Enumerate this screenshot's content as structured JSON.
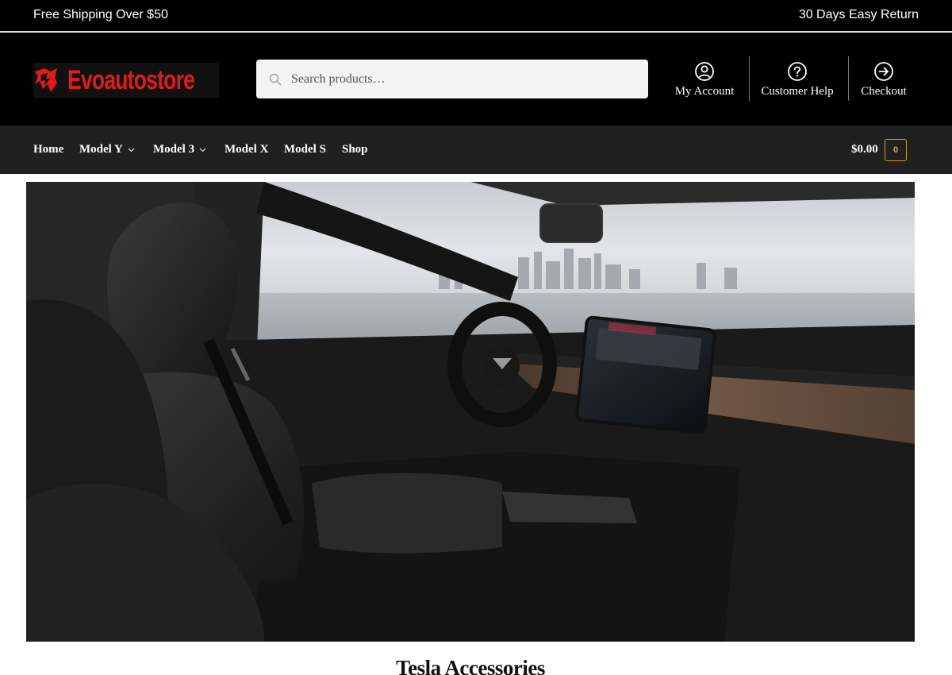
{
  "topbar": {
    "left_text": "Free Shipping Over $50",
    "right_text": "30 Days Easy Return"
  },
  "brand": {
    "logo_text": "Evoautostore",
    "accent_color": "#e11b1b"
  },
  "search": {
    "placeholder": "Search products…",
    "icon": "search-icon"
  },
  "header_links": [
    {
      "label": "My Account",
      "icon": "user-circle-icon"
    },
    {
      "label": "Customer Help",
      "icon": "question-circle-icon"
    },
    {
      "label": "Checkout",
      "icon": "arrow-right-circle-icon"
    }
  ],
  "nav": {
    "items": [
      {
        "label": "Home",
        "has_dropdown": false
      },
      {
        "label": "Model Y",
        "has_dropdown": true
      },
      {
        "label": "Model 3",
        "has_dropdown": true
      },
      {
        "label": "Model X",
        "has_dropdown": false
      },
      {
        "label": "Model S",
        "has_dropdown": false
      },
      {
        "label": "Shop",
        "has_dropdown": false
      }
    ],
    "cart_total": "$0.00",
    "cart_count": "0",
    "cart_accent": "#e0a52a"
  },
  "hero": {
    "image": "tesla-interior-hero-image"
  },
  "page": {
    "title": "Tesla Accessories"
  }
}
